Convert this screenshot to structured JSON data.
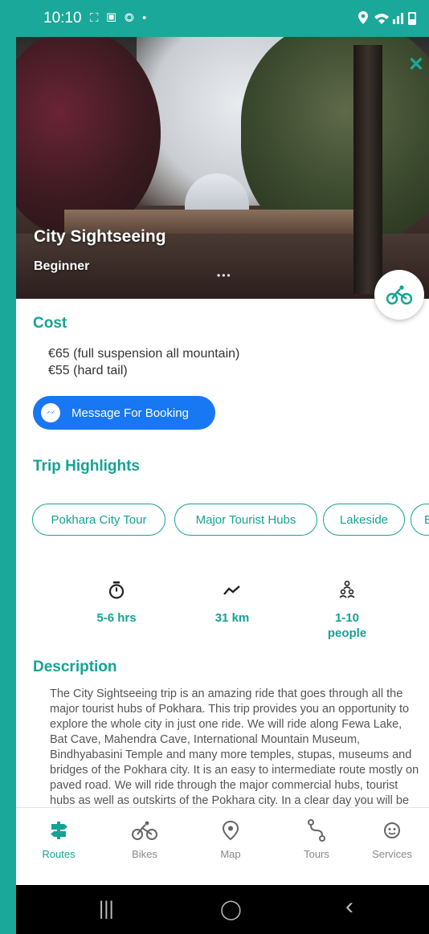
{
  "status": {
    "time": "10:10",
    "left_icons": "⛶ ▣ ◎ •",
    "right_icons": "⚲ ◠ ▮ ▮"
  },
  "hero": {
    "title": "City Sightseeing",
    "level": "Beginner",
    "dots": "•••",
    "close": "✕"
  },
  "cost": {
    "title": "Cost",
    "lines": [
      "€65 (full suspension all mountain)",
      "€55 (hard tail)"
    ]
  },
  "message_button": {
    "label": "Message For Booking"
  },
  "highlights": {
    "title": "Trip Highlights",
    "chips": [
      "Pokhara City Tour",
      "Major Tourist Hubs",
      "Lakeside",
      "B"
    ]
  },
  "stats": [
    {
      "icon": "timer-icon",
      "value": "5-6 hrs"
    },
    {
      "icon": "route-icon",
      "value": "31 km"
    },
    {
      "icon": "group-icon",
      "value": "1-10 people"
    }
  ],
  "description": {
    "title": "Description",
    "text": "The City Sightseeing trip is an amazing ride that goes through all the major tourist hubs of Pokhara. This trip provides you an opportunity to explore the whole city in just one ride. We will ride along Fewa Lake, Bat Cave, Mahendra Cave, International Mountain Museum, Bindhyabasini Temple and many more temples, stupas, museums and bridges of the Pokhara city. It is an easy to intermediate route mostly on paved road. We will ride through the major commercial hubs, tourist hubs as well as outskirts of the Pokhara city. In a clear day you will be rewarded"
  },
  "nav": {
    "items": [
      {
        "label": "Routes",
        "icon": "signpost-icon",
        "active": true
      },
      {
        "label": "Bikes",
        "icon": "bike-icon",
        "active": false
      },
      {
        "label": "Map",
        "icon": "map-pin-icon",
        "active": false
      },
      {
        "label": "Tours",
        "icon": "tours-icon",
        "active": false
      },
      {
        "label": "Services",
        "icon": "services-icon",
        "active": false
      }
    ]
  },
  "system_nav": {
    "recents": "|||",
    "home": "◯",
    "back": "‹"
  },
  "colors": {
    "accent": "#14a394",
    "status_bar": "#1aa89a",
    "messenger": "#1877f2"
  }
}
